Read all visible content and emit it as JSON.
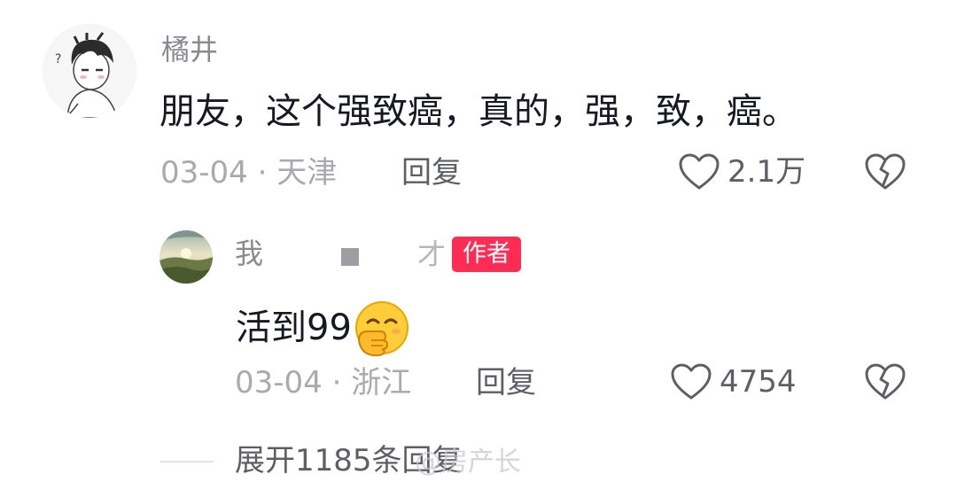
{
  "comment": {
    "username": "橘井",
    "avatar_icon": "cartoon-boy-avatar",
    "text": "朋友，这个强致癌，真的，强，致，癌。",
    "date": "03-04",
    "location": "天津",
    "meta_separator": " · ",
    "reply_label": "回复",
    "like_count": "2.1万"
  },
  "reply": {
    "username_visible_start": "我",
    "username_visible_end": "才",
    "avatar_icon": "landscape-avatar",
    "author_badge": "作者",
    "text": "活到99",
    "emoji": "hand-over-mouth-emoji",
    "date": "03-04",
    "location": "浙江",
    "meta_separator": " · ",
    "reply_label": "回复",
    "like_count": "4754"
  },
  "expand": {
    "label": "展开1185条回复"
  },
  "watermark": {
    "text": "@房产长"
  },
  "colors": {
    "primary_text": "#161823",
    "secondary_text": "#a9aab0",
    "username_text": "#8a8b91",
    "action_text": "#5e5f66",
    "author_badge": "#fe2c55"
  }
}
